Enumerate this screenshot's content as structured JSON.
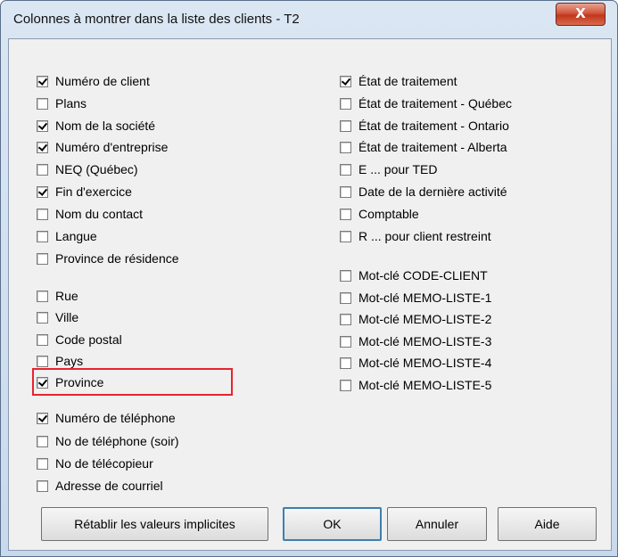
{
  "window": {
    "title": "Colonnes à montrer dans la liste des clients - T2",
    "close_label": "X"
  },
  "left_column": [
    {
      "label": "Numéro de client",
      "checked": true
    },
    {
      "label": "Plans",
      "checked": false
    },
    {
      "label": "Nom de la société",
      "checked": true
    },
    {
      "label": "Numéro d'entreprise",
      "checked": true
    },
    {
      "label": "NEQ (Québec)",
      "checked": false
    },
    {
      "label": "Fin d'exercice",
      "checked": true
    },
    {
      "label": "Nom du contact",
      "checked": false
    },
    {
      "label": "Langue",
      "checked": false
    },
    {
      "label": "Province de résidence",
      "checked": false
    },
    {
      "label": "Rue",
      "checked": false
    },
    {
      "label": "Ville",
      "checked": false
    },
    {
      "label": "Code postal",
      "checked": false
    },
    {
      "label": "Pays",
      "checked": false
    },
    {
      "label": "Province",
      "checked": true
    },
    {
      "label": "Numéro de téléphone",
      "checked": true
    },
    {
      "label": "No de téléphone (soir)",
      "checked": false
    },
    {
      "label": "No de télécopieur",
      "checked": false
    },
    {
      "label": "Adresse de courriel",
      "checked": false
    }
  ],
  "right_column": [
    {
      "label": "État de traitement",
      "checked": true
    },
    {
      "label": "État de traitement - Québec",
      "checked": false
    },
    {
      "label": "État de traitement - Ontario",
      "checked": false
    },
    {
      "label": "État de traitement - Alberta",
      "checked": false
    },
    {
      "label": "E ... pour TED",
      "checked": false
    },
    {
      "label": "Date de la dernière activité",
      "checked": false
    },
    {
      "label": "Comptable",
      "checked": false
    },
    {
      "label": "R ... pour client restreint",
      "checked": false
    },
    {
      "label": "Mot-clé CODE-CLIENT",
      "checked": false
    },
    {
      "label": "Mot-clé MEMO-LISTE-1",
      "checked": false
    },
    {
      "label": "Mot-clé MEMO-LISTE-2",
      "checked": false
    },
    {
      "label": "Mot-clé MEMO-LISTE-3",
      "checked": false
    },
    {
      "label": "Mot-clé MEMO-LISTE-4",
      "checked": false
    },
    {
      "label": "Mot-clé MEMO-LISTE-5",
      "checked": false
    }
  ],
  "buttons": {
    "restore": "Rétablir les valeurs implicites",
    "ok": "OK",
    "cancel": "Annuler",
    "help": "Aide"
  }
}
